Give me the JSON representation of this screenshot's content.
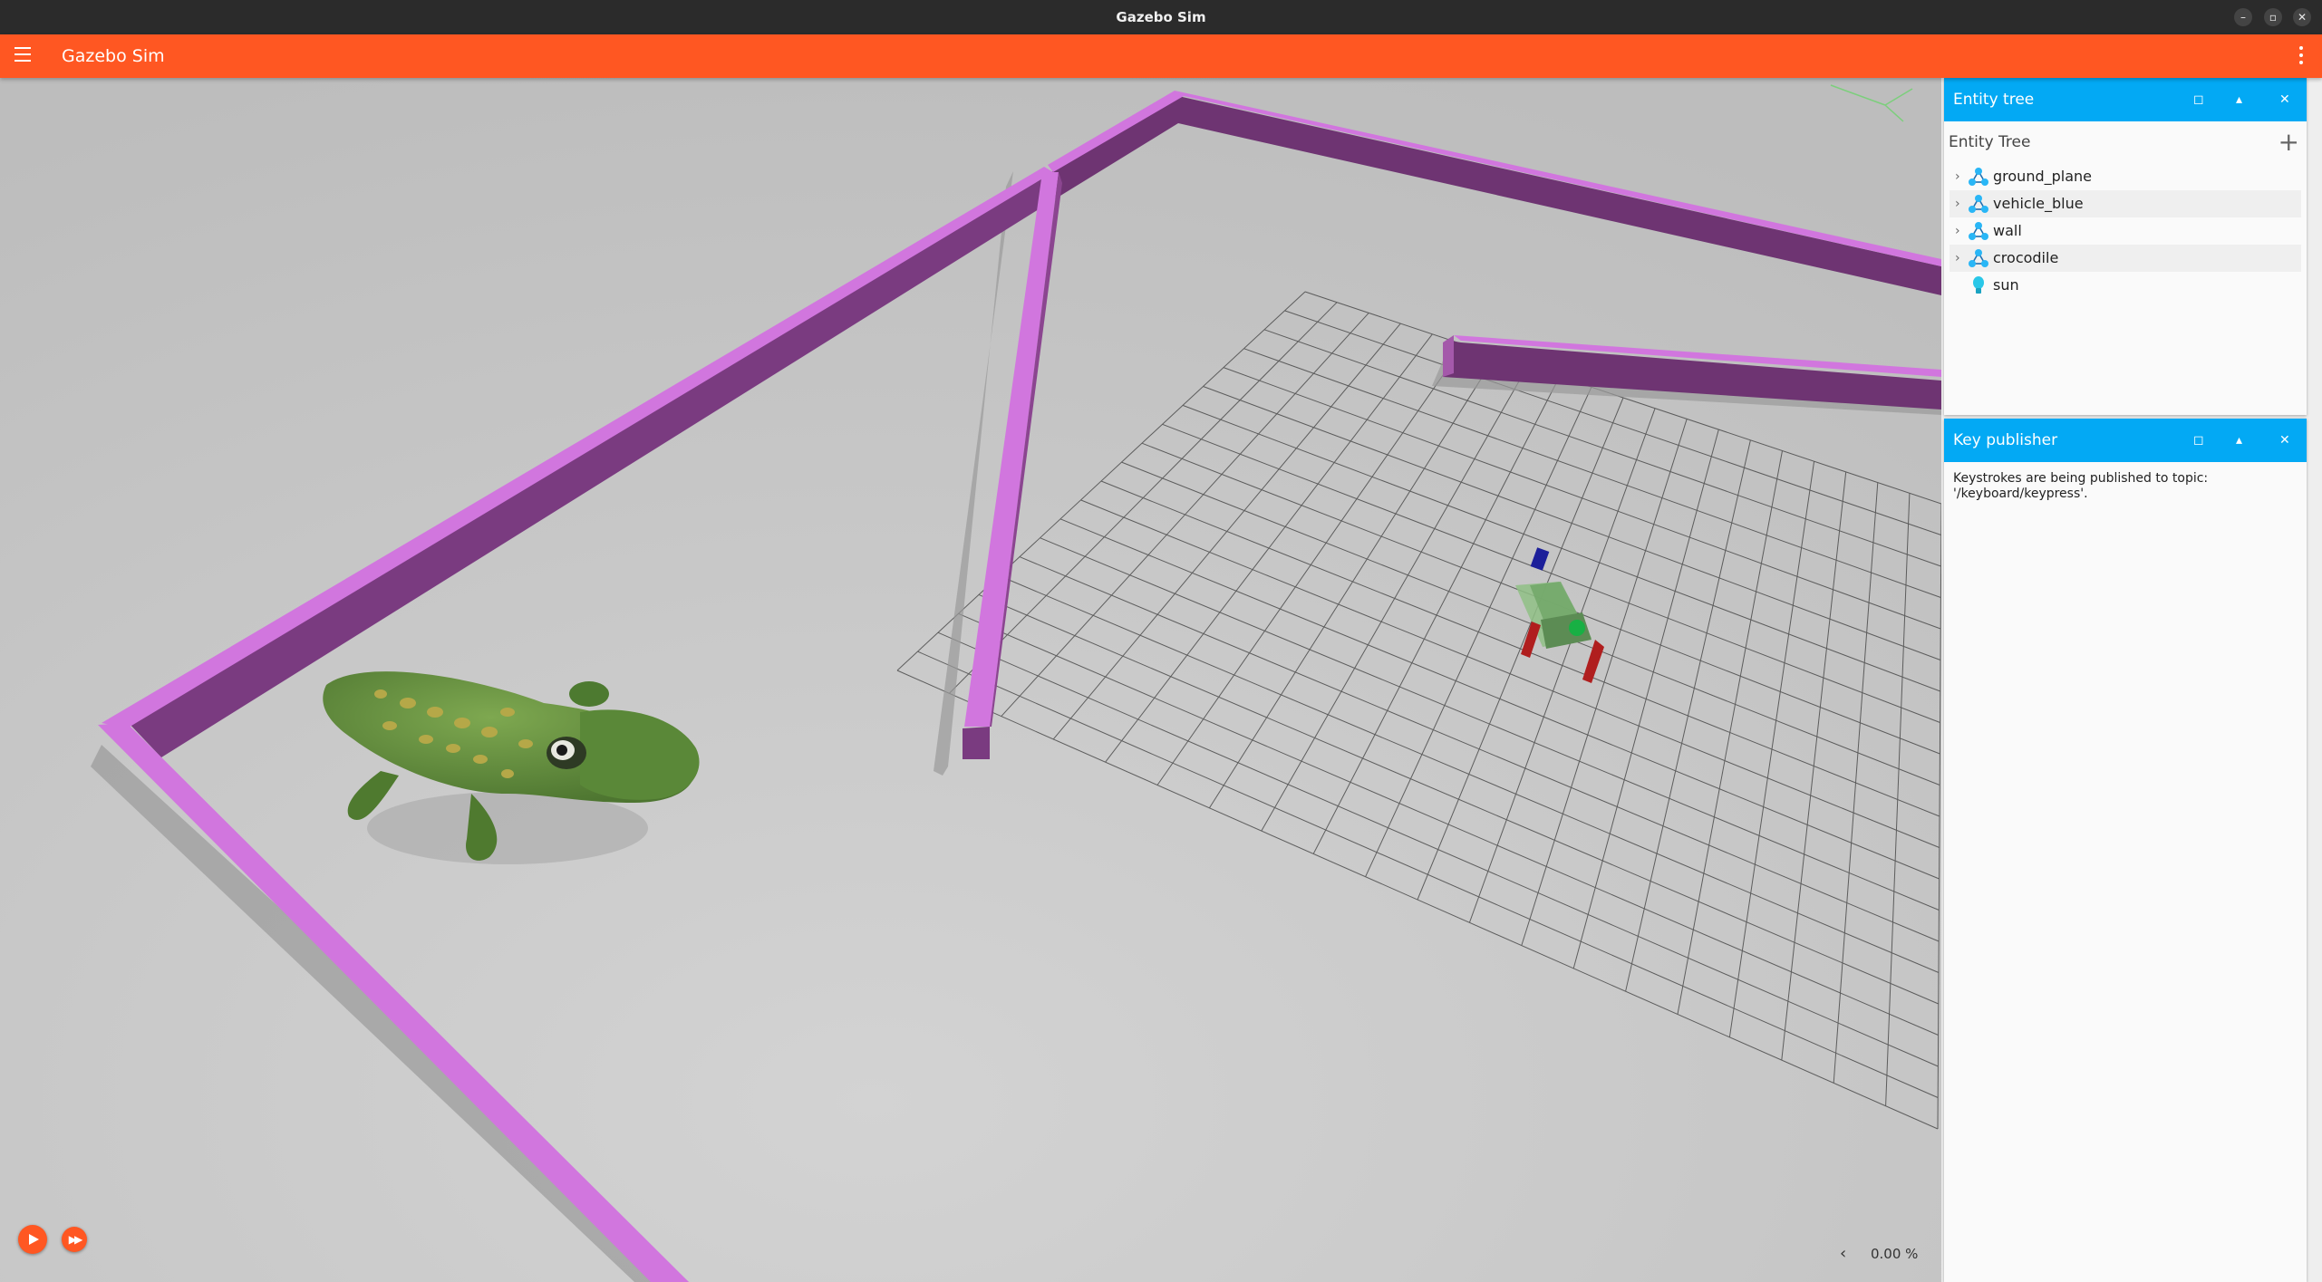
{
  "window": {
    "title": "Gazebo Sim"
  },
  "appbar": {
    "title": "Gazebo Sim"
  },
  "world": {
    "wall_color": "#d176de",
    "ground_color": "#c6c6c6",
    "grid_color": "#333333"
  },
  "controls": {
    "rtf_value": "0.00 %"
  },
  "entity_tree": {
    "panel_title": "Entity tree",
    "header": "Entity Tree",
    "items": [
      {
        "label": "ground_plane",
        "icon": "model-icon"
      },
      {
        "label": "vehicle_blue",
        "icon": "model-icon"
      },
      {
        "label": "wall",
        "icon": "model-icon"
      },
      {
        "label": "crocodile",
        "icon": "model-icon"
      },
      {
        "label": "sun",
        "icon": "light-bulb-icon"
      }
    ]
  },
  "key_publisher": {
    "panel_title": "Key publisher",
    "message": "Keystrokes are being published to topic:\n'/keyboard/keypress'."
  }
}
